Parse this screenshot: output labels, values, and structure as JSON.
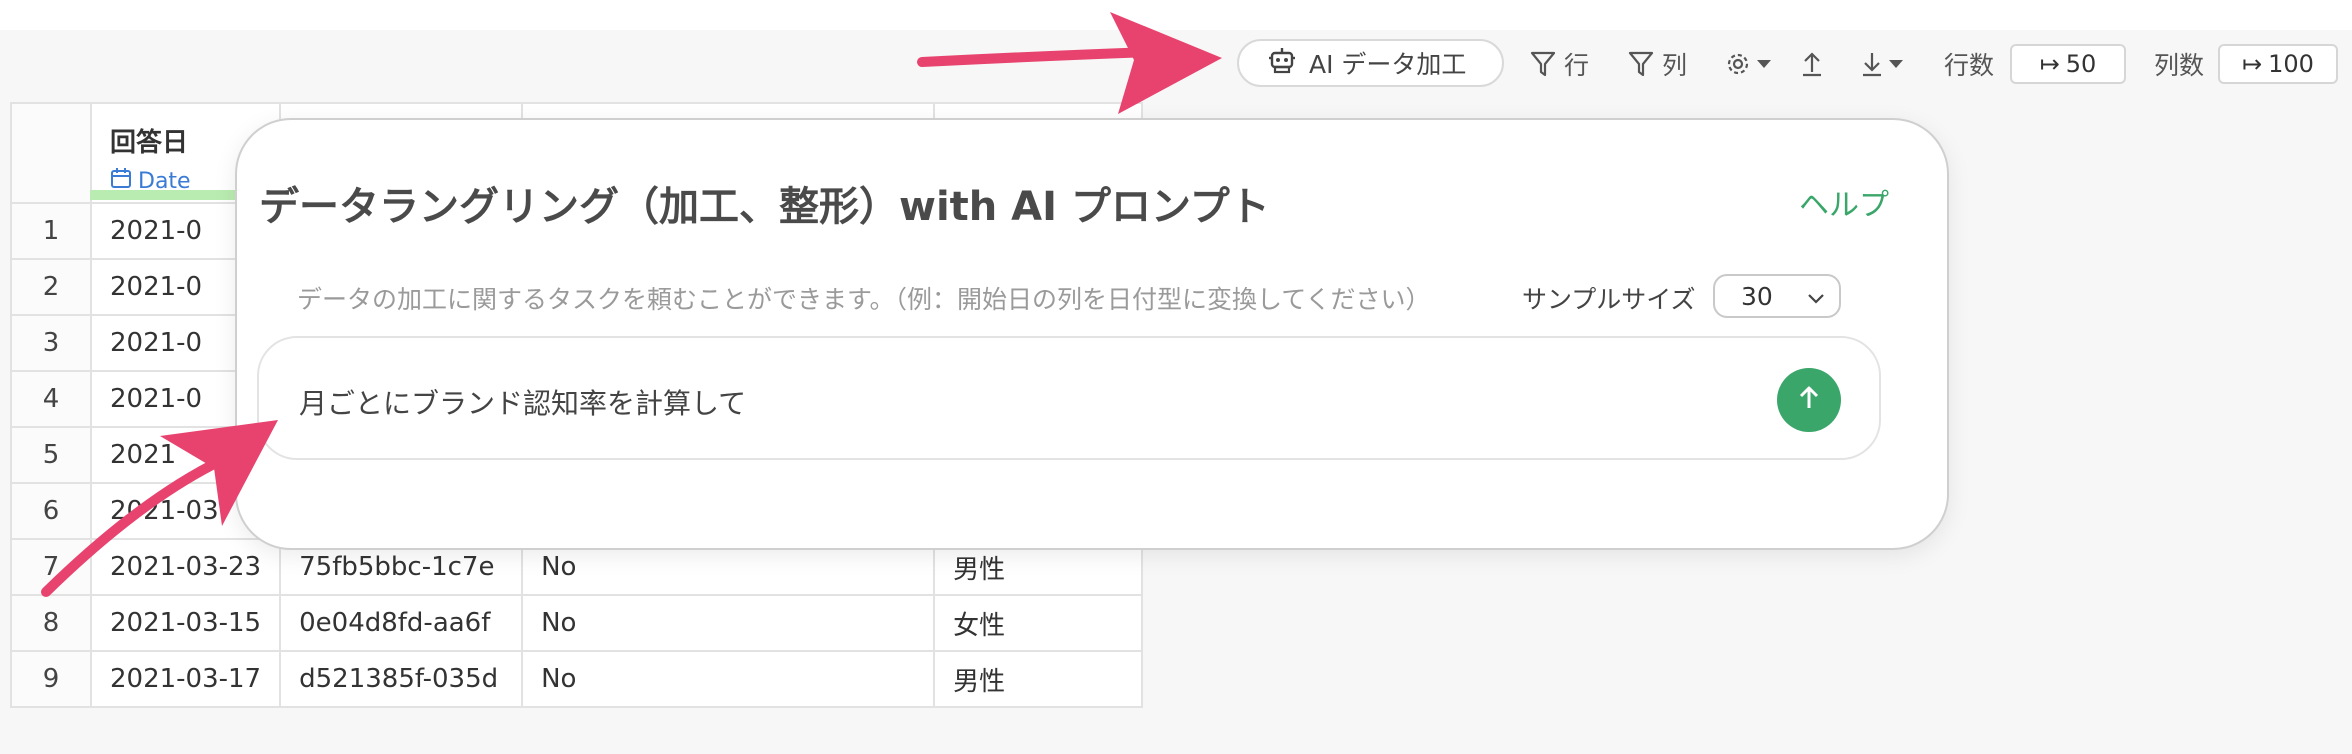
{
  "toolbar": {
    "ai_label": "AI データ加工",
    "row_filter": "行",
    "col_filter": "列",
    "rows_label": "行数",
    "rows_value": "50",
    "cols_label": "列数",
    "cols_value": "100"
  },
  "table": {
    "header": {
      "title": "回答日",
      "type": "Date"
    },
    "rows": [
      {
        "idx": "1",
        "date": "2021-0"
      },
      {
        "idx": "2",
        "date": "2021-0"
      },
      {
        "idx": "3",
        "date": "2021-0"
      },
      {
        "idx": "4",
        "date": "2021-0"
      },
      {
        "idx": "5",
        "date": "2021"
      },
      {
        "idx": "6",
        "date": "2021-03"
      },
      {
        "idx": "7",
        "date": "2021-03-23",
        "id": "75fb5bbc-1c7e",
        "aware": "No",
        "gender": "男性"
      },
      {
        "idx": "8",
        "date": "2021-03-15",
        "id": "0e04d8fd-aa6f",
        "aware": "No",
        "gender": "女性"
      },
      {
        "idx": "9",
        "date": "2021-03-17",
        "id": "d521385f-035d",
        "aware": "No",
        "gender": "男性"
      }
    ]
  },
  "modal": {
    "title": "データラングリング（加工、整形）with AI プロンプト",
    "help": "ヘルプ",
    "hint": "データの加工に関するタスクを頼むことができます。（例：開始日の列を日付型に変換してください）",
    "sample_label": "サンプルサイズ",
    "sample_value": "30",
    "prompt": "月ごとにブランド認知率を計算して"
  },
  "colors": {
    "accent_green": "#3aa66a",
    "arrow_pink": "#e8436e",
    "date_blue": "#3a7bd5"
  }
}
